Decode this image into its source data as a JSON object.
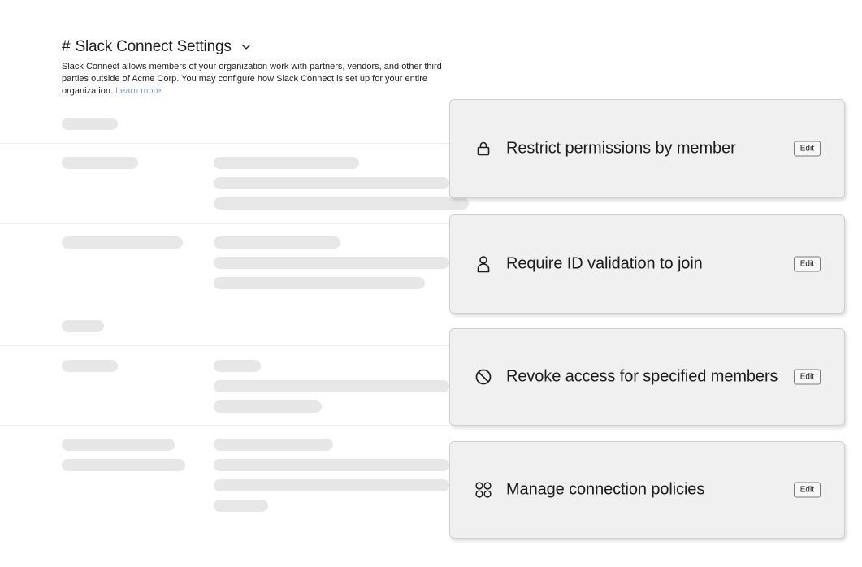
{
  "header": {
    "hash": "#",
    "title": "Slack Connect Settings",
    "description": "Slack Connect allows members of your organization work with partners, vendors, and other third parties outside of Acme Corp. You may configure how Slack Connect is set up for your entire organization.",
    "learn_more": "Learn more"
  },
  "cards": [
    {
      "label": "Restrict permissions by member",
      "icon": "lock-icon",
      "edit": "Edit"
    },
    {
      "label": "Require ID validation to join",
      "icon": "person-icon",
      "edit": "Edit"
    },
    {
      "label": "Revoke access for specified members",
      "icon": "block-icon",
      "edit": "Edit"
    },
    {
      "label": "Manage connection policies",
      "icon": "apps-icon",
      "edit": "Edit"
    }
  ]
}
